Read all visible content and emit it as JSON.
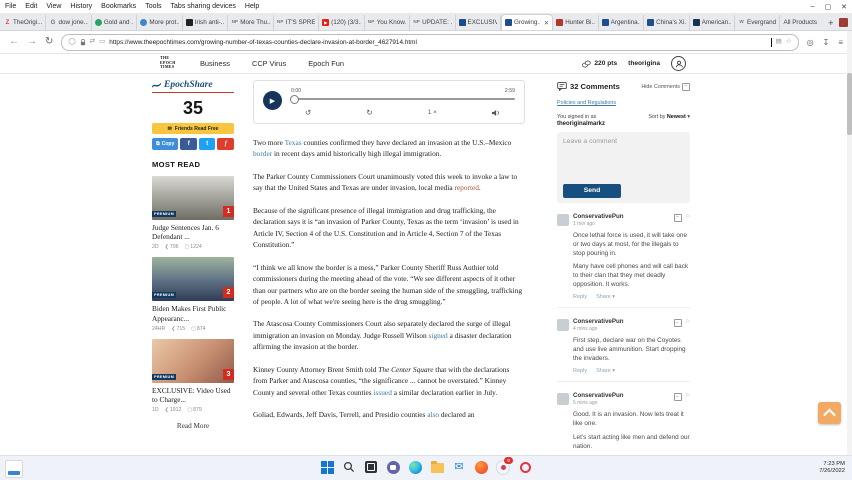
{
  "browser": {
    "menu": [
      "File",
      "Edit",
      "View",
      "History",
      "Bookmarks",
      "Tools",
      "Tabs sharing devices",
      "Help"
    ],
    "controls": {
      "min": "–",
      "max": "▢",
      "close": "✕"
    },
    "tabs": [
      {
        "label": "TheOrigi...",
        "fav": "Z"
      },
      {
        "label": "dow jone...",
        "fav": "G"
      },
      {
        "label": "Gold and ...",
        "fav": ""
      },
      {
        "label": "More prot...",
        "fav": ""
      },
      {
        "label": "Irish anti-...",
        "fav": ""
      },
      {
        "label": "More Thu...",
        "fav": "NP"
      },
      {
        "label": "IT'S SPRE...",
        "fav": "NP"
      },
      {
        "label": "(120) (3/3...",
        "fav": "▶"
      },
      {
        "label": "You Know...",
        "fav": "NP"
      },
      {
        "label": "UPDATE: ...",
        "fav": "NP"
      },
      {
        "label": "EXCLUSIV...",
        "fav": ""
      },
      {
        "label": "Growing...",
        "fav": "",
        "close": "✕"
      },
      {
        "label": "Hunter Bi...",
        "fav": ""
      },
      {
        "label": "Argentina...",
        "fav": ""
      },
      {
        "label": "China's Xi...",
        "fav": ""
      },
      {
        "label": "American...",
        "fav": ""
      },
      {
        "label": "Evergrand...",
        "fav": "W"
      },
      {
        "label": "All Products",
        "fav": ""
      }
    ],
    "new_tab": "+",
    "url": "https://www.theepochtimes.com/growing-number-of-texas-counties-declare-invasion-at-border_4627914.html"
  },
  "site_header": {
    "logo_line1": "THE",
    "logo_line2": "EPOCH",
    "logo_line3": "TIMES",
    "nav": [
      "Business",
      "CCP Virus",
      "Epoch Fun"
    ],
    "points": "220 pts",
    "username": "theorigina"
  },
  "share_rail": {
    "brand": "EpochShare",
    "count": "35",
    "friends_button": "Friends Read Free",
    "copy_label": "Copy",
    "facebook": "f",
    "twitter": "t",
    "gab": "f",
    "most_read": "MOST READ",
    "read_more": "Read More",
    "premium": "PREMIUM",
    "items": [
      {
        "rank": "1",
        "title": "Judge Sentences Jan. 6 Defendant ...",
        "age": "2D",
        "shares": "706",
        "comments": "1224"
      },
      {
        "rank": "2",
        "title": "Biden Makes First Public Appearanc...",
        "age": "24HR",
        "shares": "715",
        "comments": "874"
      },
      {
        "rank": "3",
        "title": "EXCLUSIVE: Video Used to Charge...",
        "age": "1D",
        "shares": "1912",
        "comments": "879"
      }
    ]
  },
  "player": {
    "current": "0:00",
    "duration": "2:59",
    "speed": "1 ×"
  },
  "article": {
    "paragraphs": [
      [
        {
          "t": "Two more "
        },
        {
          "t": "Texas",
          "link": true
        },
        {
          "t": " counties confirmed they have declared an invasion at the U.S.–Mexico "
        },
        {
          "t": "border",
          "link": true
        },
        {
          "t": " in recent days amid historically high illegal immigration."
        }
      ],
      [
        {
          "t": "The Parker County Commissioners Court unanimously voted this week to invoke a law to say that the United States and Texas are under invasion, local media "
        },
        {
          "t": "reported",
          "link": true,
          "v": true
        },
        {
          "t": "."
        }
      ],
      [
        {
          "t": "Because of the significant presence of illegal immigration and drug trafficking, the declaration says it is “an invasion of Parker County, Texas as the term ‘invasion’ is used in Article IV, Section 4 of the U.S. Constitution and in Article 4, Section 7 of the Texas Constitution.”"
        }
      ],
      [
        {
          "t": "“I think we all know the border is a mess,” Parker County Sheriff Russ Authier told commissioners during the meeting ahead of the vote. “We see different aspects of it other than our partners who are on the border seeing the human side of the smuggling, trafficking of people. A lot of what we're seeing here is the drug smuggling.”"
        }
      ],
      [
        {
          "t": "The Atascosa County Commissioners Court also separately declared the surge of illegal immigration an invasion on Monday. Judge Russell Wilson "
        },
        {
          "t": "signed",
          "link": true
        },
        {
          "t": " a disaster declaration affirming the invasion at the border."
        }
      ],
      [
        {
          "t": "Kinney County Attorney Brent Smith told "
        },
        {
          "t": "The Center Square",
          "i": true
        },
        {
          "t": " that with the declarations from Parker and Atascosa counties, “the significance ... cannot be overstated.” Kinney County and several other Texas counties "
        },
        {
          "t": "issued",
          "link": true
        },
        {
          "t": " a similar declaration earlier in July."
        }
      ],
      [
        {
          "t": "Goliad, Edwards, Jeff Davis, Terrell, and Presidio counties "
        },
        {
          "t": "also",
          "link": true
        },
        {
          "t": " declared an"
        }
      ]
    ]
  },
  "comments": {
    "count_label": "32 Comments",
    "hide_label": "Hide Comments",
    "policies": "Policies and Regulations",
    "signed_in": "You signed in as",
    "signed_user": "theoriginalmarkz",
    "sort_label": "Sort by ",
    "sort_value": "Newest",
    "placeholder": "Leave a comment",
    "send": "Send",
    "reply": "Reply",
    "share": "Share ▾",
    "items": [
      {
        "user": "ConservativePun",
        "time": "1 min ago",
        "p1": "Once lethal force is used, it will take one or two days at most, for the illegals to stop pouring in.",
        "p2": "Many have cell phones and will call back to their clan that they met deadly opposition. It works."
      },
      {
        "user": "ConservativePun",
        "time": "4 mins ago",
        "p1": "First step, declare war on the Coyotes and use live ammunition. Start dropping the invaders.",
        "p2": ""
      },
      {
        "user": "ConservativePun",
        "time": "5 mins ago",
        "p1": "Good. It is an invasion. Now lets treat it like one.",
        "p2": "Let's start acting like men and defend our nation."
      }
    ]
  },
  "taskbar": {
    "time": "7:23 PM",
    "date": "7/26/2022"
  },
  "colors": {
    "epoch_navy": "#17507e",
    "link_blue": "#3d7aa8",
    "link_visited": "#a8523b",
    "premium_badge": "#123a5e",
    "rank_red": "#d02c20",
    "friends_gold": "#f7c63e",
    "brand_blue": "#1b4f7d",
    "brand_underline_red": "#c23a2b",
    "scroll_top_orange": "#f2a963"
  }
}
